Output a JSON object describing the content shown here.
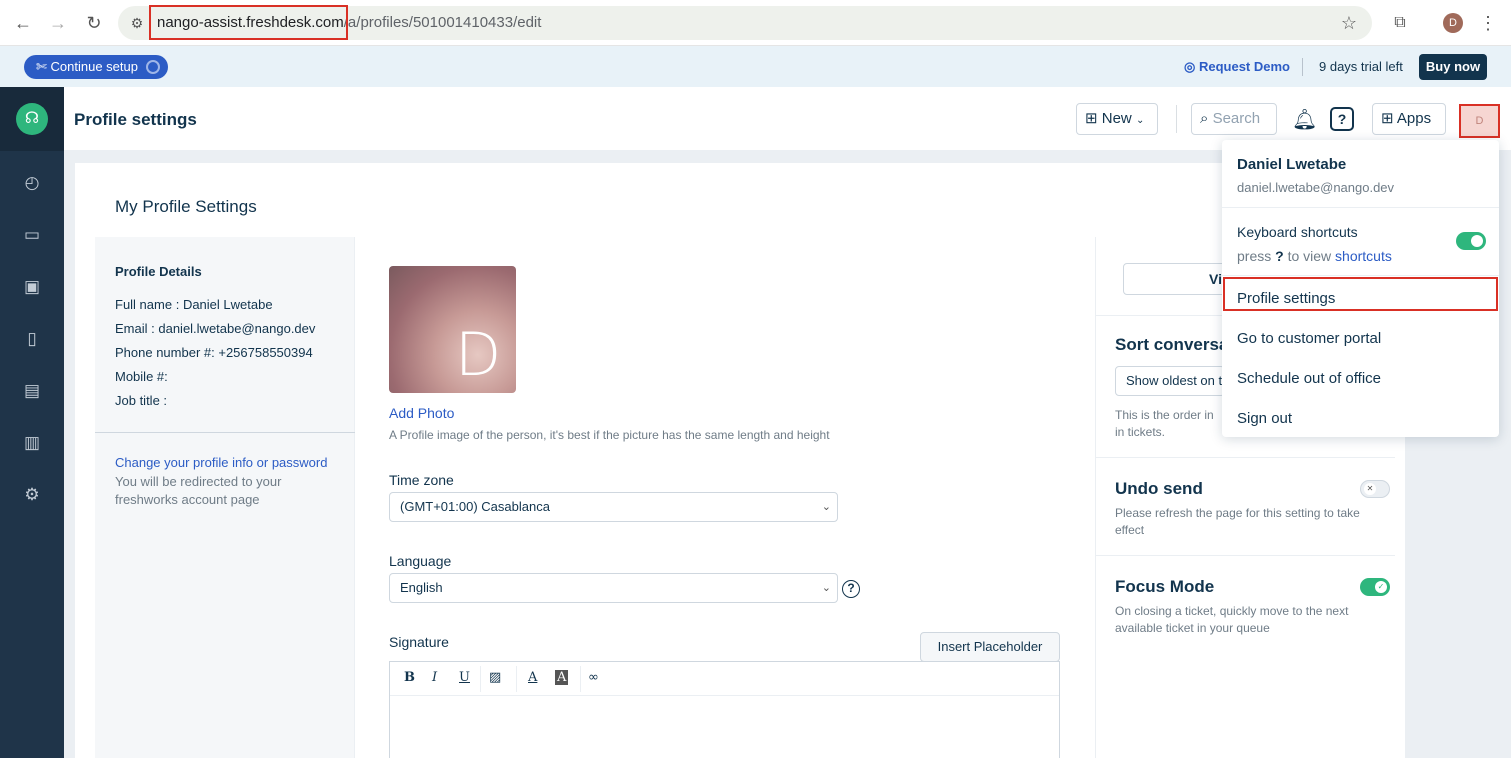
{
  "browser": {
    "url_host": "nango-assist.freshdesk.com",
    "url_path": "/a/profiles/501001410433/edit",
    "profile_initial": "D"
  },
  "banner": {
    "continue_setup": "Continue setup",
    "request_demo": "Request Demo",
    "trial": "9 days trial left",
    "buy_now": "Buy now"
  },
  "header": {
    "title": "Profile settings",
    "new_label": "New",
    "search_placeholder": "Search",
    "apps_label": "Apps",
    "avatar_initial": "D"
  },
  "main": {
    "card_title": "My Profile Settings",
    "details": {
      "heading": "Profile Details",
      "full_name_label": "Full name :",
      "full_name": "Daniel Lwetabe",
      "email_label": "Email :",
      "email": "daniel.lwetabe@nango.dev",
      "phone_label": "Phone number #:",
      "phone": "+256758550394",
      "mobile_label": "Mobile #:",
      "job_title_label": "Job title :",
      "change_link": "Change your profile info or password",
      "change_note": "You will be redirected to your freshworks account page"
    },
    "photo": {
      "letter": "D",
      "add_photo": "Add Photo",
      "note": "A Profile image of the person, it's best if the picture has the same length and height"
    },
    "timezone": {
      "label": "Time zone",
      "value": "(GMT+01:00) Casablanca"
    },
    "language": {
      "label": "Language",
      "value": "English"
    },
    "signature": {
      "label": "Signature",
      "insert_placeholder": "Insert Placeholder"
    }
  },
  "right_panel": {
    "view_btn": "Vi",
    "sort_title": "Sort conversat",
    "sort_value": "Show oldest on t",
    "sort_note": "This is the order in\nin tickets.",
    "undo_title": "Undo send",
    "undo_note": "Please refresh the page for this setting to take effect",
    "focus_title": "Focus Mode",
    "focus_note": "On closing a ticket, quickly move to the next available ticket in your queue"
  },
  "menu": {
    "name": "Daniel Lwetabe",
    "email": "daniel.lwetabe@nango.dev",
    "keyboard_shortcuts": "Keyboard shortcuts",
    "press": "press",
    "key": "?",
    "to_view": "to view",
    "shortcuts_link": "shortcuts",
    "profile_settings": "Profile settings",
    "customer_portal": "Go to customer portal",
    "out_of_office": "Schedule out of office",
    "sign_out": "Sign out"
  },
  "colors": {
    "brand_green": "#2eb67d",
    "nav_dark": "#1f3449",
    "link_blue": "#2c5cc5",
    "highlight_red": "#d93025"
  }
}
